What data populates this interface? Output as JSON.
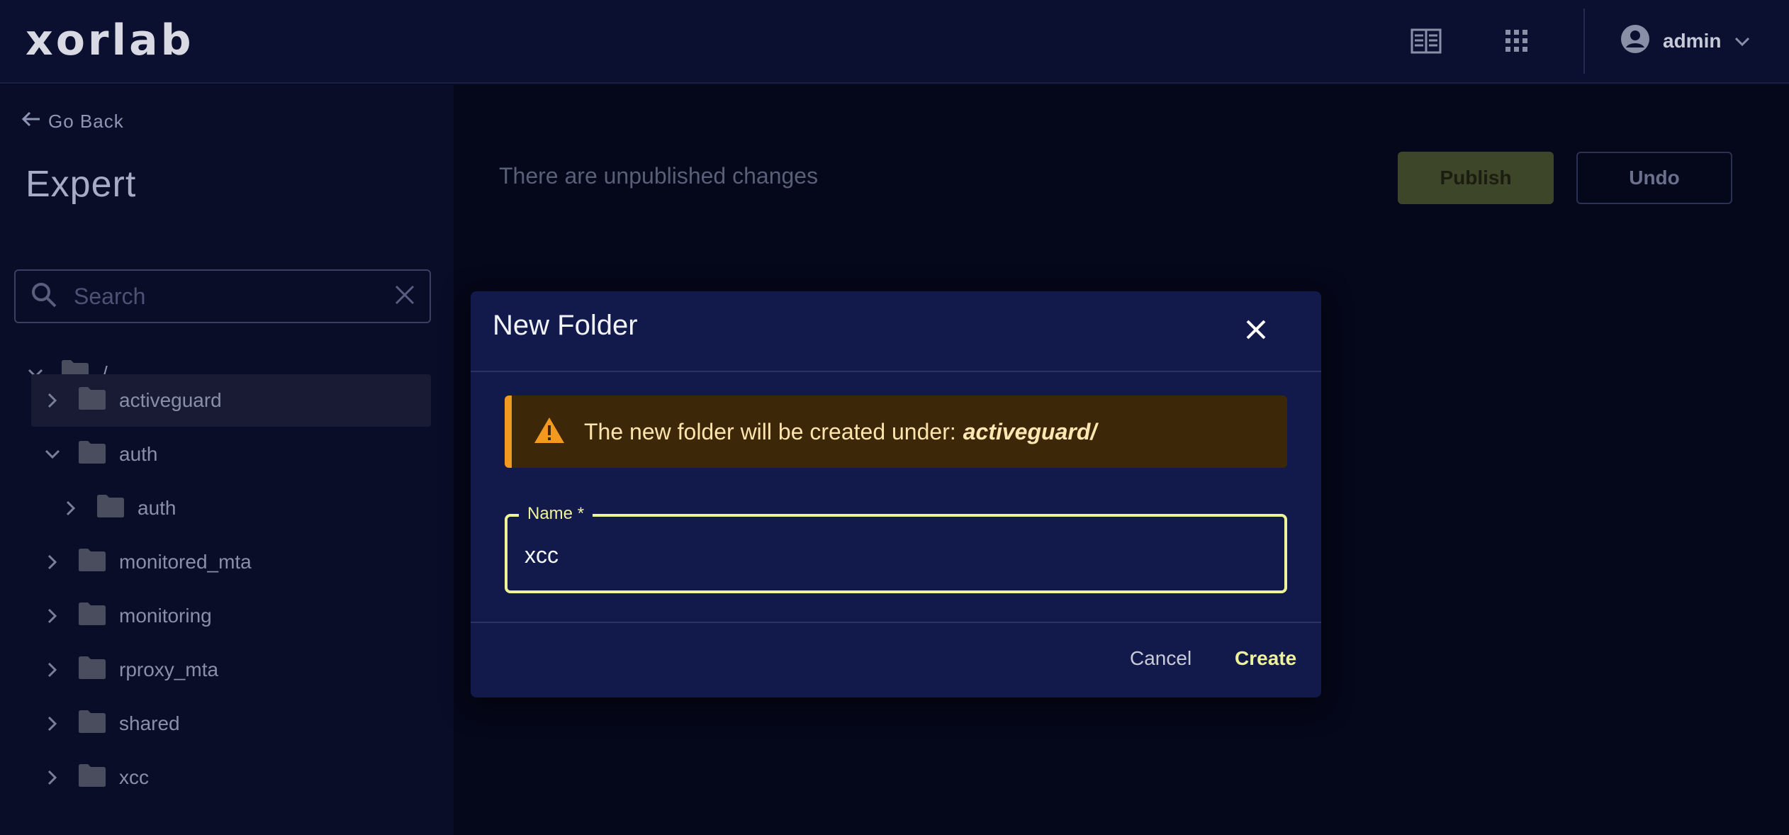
{
  "header": {
    "logo_text": "xorlab",
    "user_name": "admin",
    "icons": [
      "docs-icon",
      "apps-grid-icon",
      "account-circle-icon",
      "chevron-down-icon"
    ]
  },
  "sidebar": {
    "go_back": "Go Back",
    "title": "Expert",
    "search_placeholder": "Search",
    "tree": [
      {
        "label": "/",
        "expanded": true,
        "selected": false
      },
      {
        "label": "activeguard",
        "expanded": false,
        "selected": true
      },
      {
        "label": "auth",
        "expanded": true,
        "selected": false
      },
      {
        "label": "auth",
        "expanded": false,
        "selected": false
      },
      {
        "label": "monitored_mta",
        "expanded": false,
        "selected": false
      },
      {
        "label": "monitoring",
        "expanded": false,
        "selected": false
      },
      {
        "label": "rproxy_mta",
        "expanded": false,
        "selected": false
      },
      {
        "label": "shared",
        "expanded": false,
        "selected": false
      },
      {
        "label": "xcc",
        "expanded": false,
        "selected": false
      }
    ]
  },
  "main": {
    "unpublished_text": "There are unpublished changes",
    "publish_label": "Publish",
    "undo_label": "Undo"
  },
  "modal": {
    "title": "New Folder",
    "alert_text": "The new folder will be created under:",
    "alert_path": "activeguard/",
    "name_label": "Name *",
    "name_value": "xcc",
    "cancel_label": "Cancel",
    "create_label": "Create"
  },
  "colors": {
    "accent": "#eef39a",
    "modal_bg": "#111a4b",
    "warning": "#f29a1f",
    "warning_bg": "#3c2708"
  }
}
